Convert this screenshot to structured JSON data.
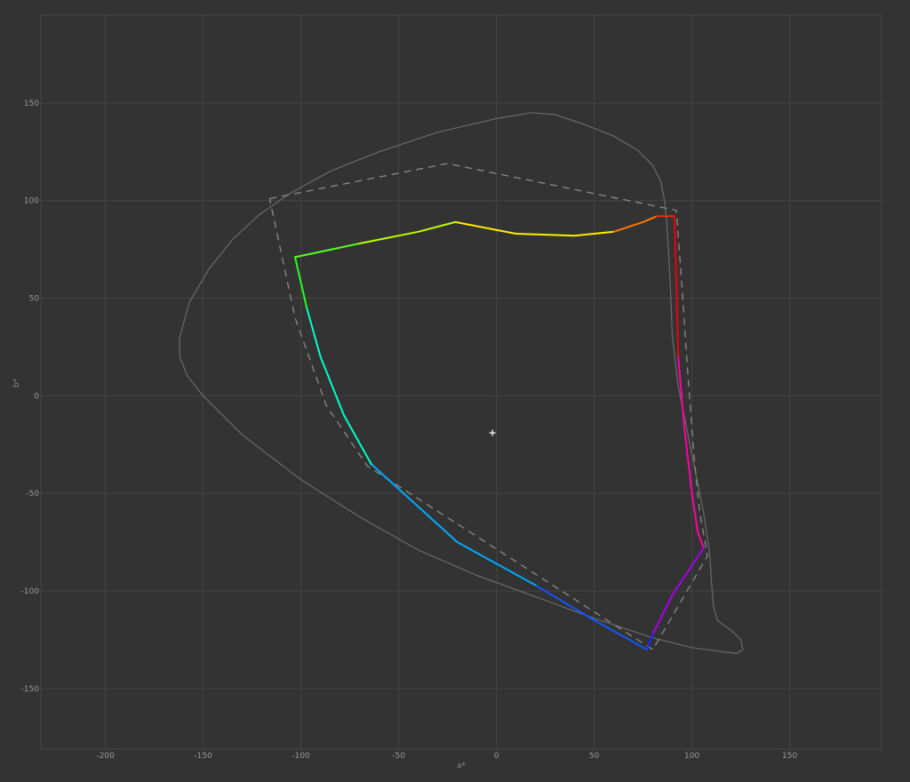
{
  "chart_data": {
    "type": "line",
    "title": "",
    "xlabel": "a*",
    "ylabel": "b*",
    "xlim": [
      -233,
      197
    ],
    "ylim": [
      -181,
      195
    ],
    "x_ticks": [
      -200,
      -150,
      -100,
      -50,
      0,
      50,
      100,
      150
    ],
    "y_ticks": [
      150,
      100,
      50,
      0,
      -50,
      -100,
      -150
    ],
    "x_tick_labels": [
      "-200",
      "-150",
      "-100",
      "-50",
      "0",
      "50",
      "100",
      "150"
    ],
    "y_tick_labels": [
      "150",
      "100",
      "50",
      "0",
      "-50",
      "-100",
      "-150"
    ],
    "grid": true,
    "white_point": {
      "x": -2,
      "y": -19
    },
    "colors": {
      "background": "#333333",
      "grid": "#444444",
      "frame": "#474747",
      "outline": "#6a6a6a",
      "dashed": "#8a8a8a",
      "white_point": "#ffffff"
    },
    "series": [
      {
        "style": "solid-thin",
        "points": [
          [
            -162,
            20
          ],
          [
            -162,
            30
          ],
          [
            -157,
            48
          ],
          [
            -147,
            65
          ],
          [
            -135,
            80
          ],
          [
            -121,
            93
          ],
          [
            -105,
            104
          ],
          [
            -85,
            115
          ],
          [
            -60,
            125
          ],
          [
            -30,
            135
          ],
          [
            0,
            142
          ],
          [
            18,
            145
          ],
          [
            30,
            144
          ],
          [
            45,
            139
          ],
          [
            60,
            133
          ],
          [
            72,
            126
          ],
          [
            80,
            118
          ],
          [
            84,
            110
          ],
          [
            86,
            100
          ],
          [
            87,
            90
          ],
          [
            88,
            75
          ],
          [
            89,
            55
          ],
          [
            90,
            30
          ],
          [
            93,
            5
          ],
          [
            97,
            -15
          ],
          [
            102,
            -40
          ],
          [
            106,
            -60
          ],
          [
            109,
            -80
          ],
          [
            110,
            -95
          ],
          [
            111,
            -108
          ],
          [
            113,
            -115
          ],
          [
            117,
            -118
          ],
          [
            121,
            -121
          ],
          [
            125,
            -125
          ],
          [
            126,
            -130
          ],
          [
            123,
            -132
          ],
          [
            115,
            -131
          ],
          [
            100,
            -129
          ],
          [
            80,
            -124
          ],
          [
            50,
            -114
          ],
          [
            20,
            -103
          ],
          [
            -10,
            -92
          ],
          [
            -40,
            -79
          ],
          [
            -70,
            -62
          ],
          [
            -100,
            -43
          ],
          [
            -130,
            -20
          ],
          [
            -150,
            0
          ],
          [
            -158,
            10
          ],
          [
            -162,
            20
          ]
        ]
      },
      {
        "style": "dashed",
        "points": [
          [
            -116,
            101
          ],
          [
            -25,
            119
          ],
          [
            92,
            95
          ],
          [
            95,
            55
          ],
          [
            98,
            10
          ],
          [
            101,
            -30
          ],
          [
            104,
            -60
          ],
          [
            108,
            -82
          ],
          [
            80,
            -130
          ],
          [
            -66,
            -36
          ],
          [
            -87,
            -5
          ],
          [
            -103,
            40
          ],
          [
            -116,
            101
          ]
        ]
      },
      {
        "style": "gradient",
        "segments": [
          {
            "color": "#ffee00",
            "points": [
              [
                -21,
                89
              ],
              [
                10,
                83
              ],
              [
                40,
                82
              ],
              [
                60,
                84
              ]
            ]
          },
          {
            "color": "#ff7700",
            "points": [
              [
                60,
                84
              ],
              [
                75,
                89
              ],
              [
                82,
                92
              ]
            ]
          },
          {
            "color": "#ff2200",
            "points": [
              [
                82,
                92
              ],
              [
                91,
                92
              ]
            ]
          },
          {
            "color": "#ee0011",
            "points": [
              [
                91,
                92
              ],
              [
                92,
                60
              ],
              [
                93,
                20
              ]
            ]
          },
          {
            "color": "#ff00aa",
            "points": [
              [
                93,
                20
              ],
              [
                96,
                -15
              ],
              [
                100,
                -50
              ],
              [
                103,
                -70
              ],
              [
                106,
                -78
              ]
            ]
          },
          {
            "color": "#aa00ee",
            "points": [
              [
                106,
                -78
              ],
              [
                90,
                -102
              ],
              [
                80,
                -122
              ]
            ]
          },
          {
            "color": "#2222ff",
            "points": [
              [
                80,
                -122
              ],
              [
                77,
                -130
              ]
            ]
          },
          {
            "color": "#1155ff",
            "points": [
              [
                77,
                -130
              ],
              [
                50,
                -115
              ],
              [
                20,
                -97
              ]
            ]
          },
          {
            "color": "#00aaff",
            "points": [
              [
                20,
                -97
              ],
              [
                -20,
                -75
              ],
              [
                -64,
                -35
              ]
            ]
          },
          {
            "color": "#00ffcc",
            "points": [
              [
                -64,
                -35
              ],
              [
                -78,
                -10
              ],
              [
                -90,
                20
              ],
              [
                -97,
                45
              ]
            ]
          },
          {
            "color": "#22ff22",
            "points": [
              [
                -97,
                45
              ],
              [
                -103,
                71
              ]
            ]
          },
          {
            "color": "#55ff22",
            "points": [
              [
                -103,
                71
              ],
              [
                -70,
                78
              ]
            ]
          },
          {
            "color": "#bbff00",
            "points": [
              [
                -70,
                78
              ],
              [
                -40,
                84
              ],
              [
                -21,
                89
              ]
            ]
          }
        ]
      }
    ]
  }
}
